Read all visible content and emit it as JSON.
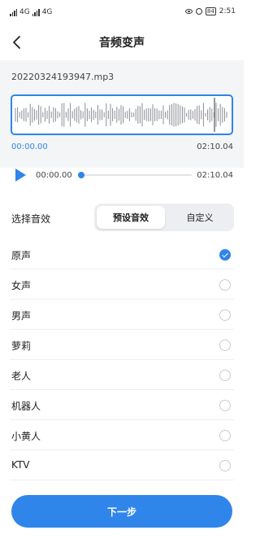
{
  "status_bar": {
    "time": "2:51",
    "battery": "84",
    "signal1_label": "4G",
    "signal2_label": "4G"
  },
  "header": {
    "title": "音频变声",
    "back_icon": "chevron-left-icon"
  },
  "file": {
    "name": "20220324193947.mp3"
  },
  "waveform": {
    "start_time": "00:00.00",
    "end_time": "02:10.04",
    "accent_color": "#2f85ea"
  },
  "player": {
    "current_time": "00:00.00",
    "total_time": "02:10.04",
    "progress": 0,
    "play_icon": "play-icon"
  },
  "effect": {
    "label": "选择音效",
    "tabs": [
      {
        "label": "预设音效",
        "selected": true
      },
      {
        "label": "自定义",
        "selected": false
      }
    ]
  },
  "voices": [
    {
      "label": "原声",
      "checked": true
    },
    {
      "label": "女声",
      "checked": false
    },
    {
      "label": "男声",
      "checked": false
    },
    {
      "label": "萝莉",
      "checked": false
    },
    {
      "label": "老人",
      "checked": false
    },
    {
      "label": "机器人",
      "checked": false
    },
    {
      "label": "小黄人",
      "checked": false
    },
    {
      "label": "KTV",
      "checked": false
    }
  ],
  "next_button": {
    "label": "下一步"
  }
}
